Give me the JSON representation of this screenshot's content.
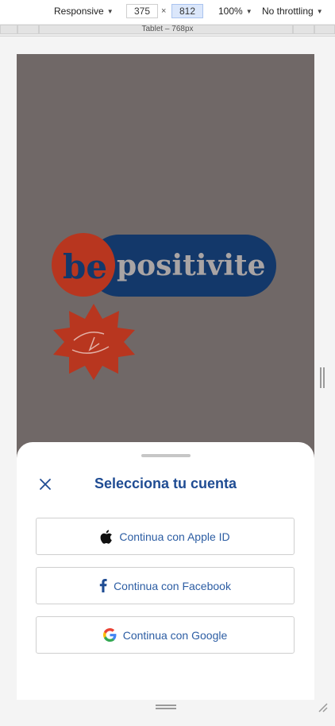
{
  "devtools": {
    "device": "Responsive",
    "width": "375",
    "times": "×",
    "height": "812",
    "zoom": "100%",
    "throttling": "No throttling",
    "breakpoint_label": "Tablet – 768px"
  },
  "splash": {
    "brand_be": "be",
    "brand_word": "positivite",
    "colors": {
      "backdrop": "#706867",
      "brand_red": "#b8361f",
      "brand_blue": "#13386a",
      "wordmark": "#a9a4a4"
    }
  },
  "sheet": {
    "title": "Selecciona tu cuenta",
    "close_icon": "close-icon",
    "buttons": [
      {
        "label": "Continua con Apple ID",
        "icon": "apple-icon"
      },
      {
        "label": "Continua con Facebook",
        "icon": "facebook-icon"
      },
      {
        "label": "Continua con Google",
        "icon": "google-icon"
      }
    ],
    "colors": {
      "accent": "#1f4c93",
      "button_text": "#2c5da3"
    }
  }
}
